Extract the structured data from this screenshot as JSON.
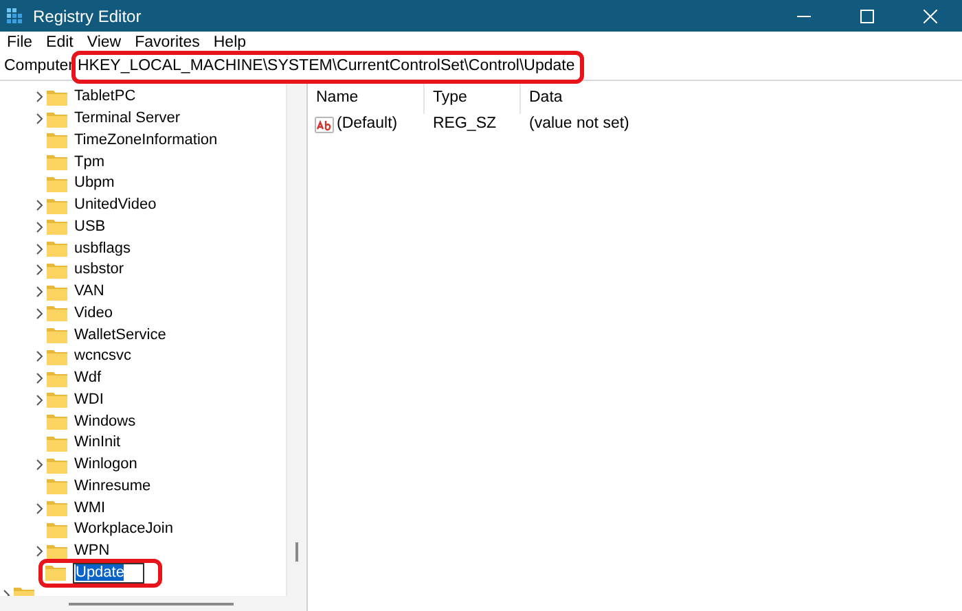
{
  "window": {
    "title": "Registry Editor"
  },
  "menu": [
    "File",
    "Edit",
    "View",
    "Favorites",
    "Help"
  ],
  "address": {
    "label": "Computer",
    "value": "HKEY_LOCAL_MACHINE\\SYSTEM\\CurrentControlSet\\Control\\Update",
    "highlighted": true
  },
  "tree": {
    "items": [
      {
        "label": "TabletPC",
        "expandable": true
      },
      {
        "label": "Terminal Server",
        "expandable": true
      },
      {
        "label": "TimeZoneInformation",
        "expandable": false
      },
      {
        "label": "Tpm",
        "expandable": false
      },
      {
        "label": "Ubpm",
        "expandable": false
      },
      {
        "label": "UnitedVideo",
        "expandable": true
      },
      {
        "label": "USB",
        "expandable": true
      },
      {
        "label": "usbflags",
        "expandable": true
      },
      {
        "label": "usbstor",
        "expandable": true
      },
      {
        "label": "VAN",
        "expandable": true
      },
      {
        "label": "Video",
        "expandable": true
      },
      {
        "label": "WalletService",
        "expandable": false
      },
      {
        "label": "wcncsvc",
        "expandable": true
      },
      {
        "label": "Wdf",
        "expandable": true
      },
      {
        "label": "WDI",
        "expandable": true
      },
      {
        "label": "Windows",
        "expandable": false
      },
      {
        "label": "WinInit",
        "expandable": false
      },
      {
        "label": "Winlogon",
        "expandable": true
      },
      {
        "label": "Winresume",
        "expandable": false
      },
      {
        "label": "WMI",
        "expandable": true
      },
      {
        "label": "WorkplaceJoin",
        "expandable": false
      },
      {
        "label": "WPN",
        "expandable": true
      },
      {
        "label": "Update",
        "expandable": false,
        "editing": true,
        "highlighted": true
      }
    ],
    "after": [
      {
        "expandable": true
      }
    ]
  },
  "values": {
    "columns": [
      "Name",
      "Type",
      "Data"
    ],
    "rows": [
      {
        "name": "(Default)",
        "type": "REG_SZ",
        "data": "(value not set)"
      }
    ]
  }
}
